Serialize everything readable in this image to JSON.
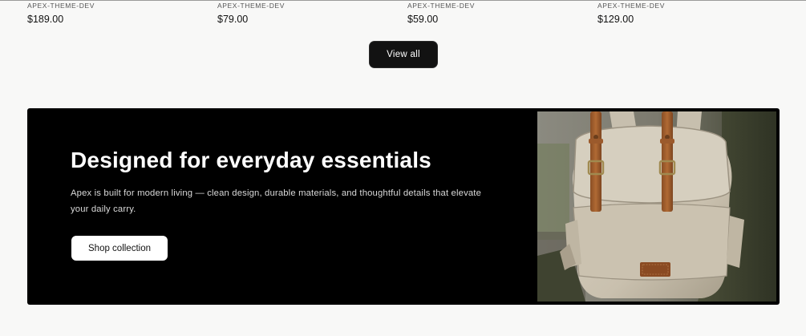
{
  "products": [
    {
      "vendor": "APEX-THEME-DEV",
      "price": "$189.00"
    },
    {
      "vendor": "APEX-THEME-DEV",
      "price": "$79.00"
    },
    {
      "vendor": "APEX-THEME-DEV",
      "price": "$59.00"
    },
    {
      "vendor": "APEX-THEME-DEV",
      "price": "$129.00"
    }
  ],
  "view_all_label": "View all",
  "banner": {
    "title": "Designed for everyday essentials",
    "text": "Apex is built for modern living — clean design, durable materials, and thoughtful details that elevate your daily carry.",
    "button_label": "Shop collection",
    "image_subject": "canvas-backpack-photo"
  },
  "colors": {
    "page_background": "#f8f8f7",
    "button_dark": "#121212",
    "banner_background": "#000000",
    "button_light": "#ffffff"
  }
}
